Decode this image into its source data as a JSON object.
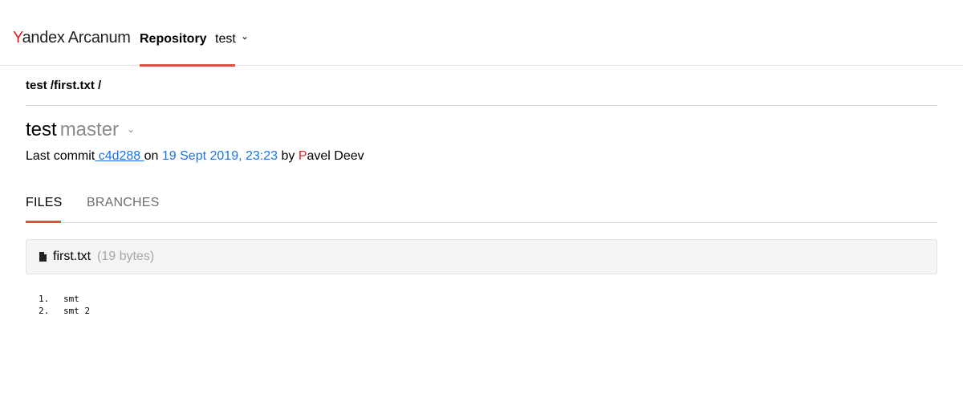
{
  "header": {
    "logo_y": "Y",
    "logo_rest": "andex",
    "logo_product": "Arcanum",
    "nav_label": "Repository",
    "repo_name": "test"
  },
  "breadcrumb": {
    "repo": "test",
    "path": "/first.txt",
    "sep": "/"
  },
  "title": {
    "repo": "test",
    "branch": "master"
  },
  "commit": {
    "prefix": "Last commit",
    "hash": " c4d288 ",
    "on": "on ",
    "date": "19 Sept 2019, 23:23",
    "by": " by ",
    "author_first": "P",
    "author_rest": "avel Deev"
  },
  "tabs": {
    "files": "FILES",
    "branches": "BRANCHES"
  },
  "file": {
    "name": "first.txt",
    "size": "(19 bytes)"
  },
  "code_lines": [
    {
      "num": "1.",
      "text": "smt"
    },
    {
      "num": "2.",
      "text": "smt 2"
    }
  ],
  "colors": {
    "accent": "#e34d43",
    "link": "#1a73e8",
    "brand_red": "#e31e24"
  }
}
